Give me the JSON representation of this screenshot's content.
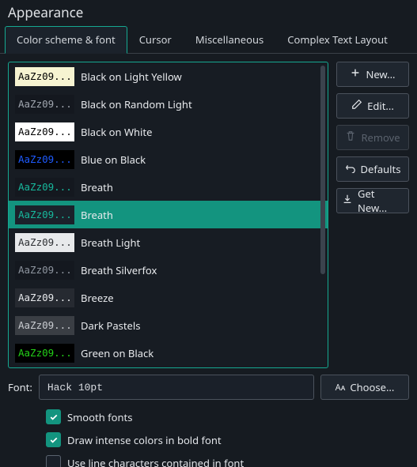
{
  "title": "Appearance",
  "tabs": [
    {
      "label": "Color scheme & font",
      "active": true
    },
    {
      "label": "Cursor",
      "active": false
    },
    {
      "label": "Miscellaneous",
      "active": false
    },
    {
      "label": "Complex Text Layout",
      "active": false
    }
  ],
  "sample_text": "AaZz09...",
  "schemes": [
    {
      "name": "Black on Light Yellow",
      "bg": "#f6f3d1",
      "fg": "#000000",
      "selected": false
    },
    {
      "name": "Black on Random Light",
      "bg": "#14181f",
      "fg": "#a0a6af",
      "selected": false
    },
    {
      "name": "Black on White",
      "bg": "#ffffff",
      "fg": "#000000",
      "selected": false
    },
    {
      "name": "Blue on Black",
      "bg": "#000000",
      "fg": "#1e5bff",
      "selected": false
    },
    {
      "name": "Breath",
      "bg": "#14181f",
      "fg": "#17b89c",
      "selected": false
    },
    {
      "name": "Breath",
      "bg": "#1b222b",
      "fg": "#17b89c",
      "selected": true
    },
    {
      "name": "Breath Light",
      "bg": "#e7e9eb",
      "fg": "#2c2f33",
      "selected": false
    },
    {
      "name": "Breath Silverfox",
      "bg": "#14181f",
      "fg": "#8d949e",
      "selected": false
    },
    {
      "name": "Breeze",
      "bg": "#262a31",
      "fg": "#e6e8eb",
      "selected": false
    },
    {
      "name": "Dark Pastels",
      "bg": "#3a3e44",
      "fg": "#c9ccd1",
      "selected": false
    },
    {
      "name": "Green on Black",
      "bg": "#000000",
      "fg": "#23d018",
      "selected": false
    }
  ],
  "actions": {
    "new": "New...",
    "edit": "Edit...",
    "remove": "Remove",
    "defaults": "Defaults",
    "getnew": "Get New..."
  },
  "font": {
    "label": "Font:",
    "value": "Hack 10pt",
    "choose": "Choose..."
  },
  "checks": {
    "smooth": {
      "label": "Smooth fonts",
      "checked": true
    },
    "bold": {
      "label": "Draw intense colors in bold font",
      "checked": true
    },
    "linechar": {
      "label": "Use line characters contained in font",
      "checked": false
    }
  }
}
